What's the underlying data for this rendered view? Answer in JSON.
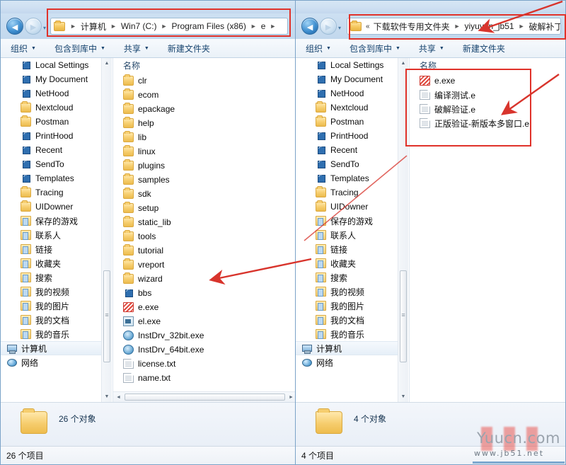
{
  "left_window": {
    "nav": {
      "back_label": "◄",
      "forward_label": "►",
      "dropdown": "▾"
    },
    "address": {
      "crumbs": [
        "计算机",
        "Win7 (C:)",
        "Program Files (x86)",
        "e"
      ],
      "separator": "►"
    },
    "toolbar": {
      "items": [
        {
          "label": "组织",
          "caret": "▼"
        },
        {
          "label": "包含到库中",
          "caret": "▼"
        },
        {
          "label": "共享",
          "caret": "▼"
        },
        {
          "label": "新建文件夹",
          "caret": ""
        }
      ]
    },
    "tree": [
      {
        "label": "Local Settings",
        "icon": "shortcut-icon"
      },
      {
        "label": "My Document",
        "icon": "shortcut-icon"
      },
      {
        "label": "NetHood",
        "icon": "shortcut-icon"
      },
      {
        "label": "Nextcloud",
        "icon": "folder-icon"
      },
      {
        "label": "Postman",
        "icon": "folder-icon"
      },
      {
        "label": "PrintHood",
        "icon": "shortcut-icon"
      },
      {
        "label": "Recent",
        "icon": "shortcut-icon"
      },
      {
        "label": "SendTo",
        "icon": "shortcut-icon"
      },
      {
        "label": "Templates",
        "icon": "shortcut-icon"
      },
      {
        "label": "Tracing",
        "icon": "folder-icon"
      },
      {
        "label": "UIDowner",
        "icon": "folder-icon"
      },
      {
        "label": "保存的游戏",
        "icon": "sys-folder-icon"
      },
      {
        "label": "联系人",
        "icon": "sys-folder-icon"
      },
      {
        "label": "链接",
        "icon": "sys-folder-icon"
      },
      {
        "label": "收藏夹",
        "icon": "sys-folder-icon"
      },
      {
        "label": "搜索",
        "icon": "sys-folder-icon"
      },
      {
        "label": "我的视频",
        "icon": "sys-folder-icon"
      },
      {
        "label": "我的图片",
        "icon": "sys-folder-icon"
      },
      {
        "label": "我的文档",
        "icon": "sys-folder-icon"
      },
      {
        "label": "我的音乐",
        "icon": "sys-folder-icon"
      }
    ],
    "tree_roots": [
      {
        "label": "计算机",
        "icon": "computer-icon"
      },
      {
        "label": "网络",
        "icon": "network-icon"
      }
    ],
    "column_header": "名称",
    "files": [
      {
        "name": "clr",
        "icon": "folder-icon"
      },
      {
        "name": "ecom",
        "icon": "folder-icon"
      },
      {
        "name": "epackage",
        "icon": "folder-icon"
      },
      {
        "name": "help",
        "icon": "folder-icon"
      },
      {
        "name": "lib",
        "icon": "folder-icon"
      },
      {
        "name": "linux",
        "icon": "folder-icon"
      },
      {
        "name": "plugins",
        "icon": "folder-icon"
      },
      {
        "name": "samples",
        "icon": "folder-icon"
      },
      {
        "name": "sdk",
        "icon": "folder-icon"
      },
      {
        "name": "setup",
        "icon": "folder-icon"
      },
      {
        "name": "static_lib",
        "icon": "folder-icon"
      },
      {
        "name": "tools",
        "icon": "folder-icon"
      },
      {
        "name": "tutorial",
        "icon": "folder-icon"
      },
      {
        "name": "vreport",
        "icon": "folder-icon"
      },
      {
        "name": "wizard",
        "icon": "folder-icon"
      },
      {
        "name": "bbs",
        "icon": "shortcut-icon"
      },
      {
        "name": "e.exe",
        "icon": "exe-red-icon"
      },
      {
        "name": "el.exe",
        "icon": "exe-blue-icon"
      },
      {
        "name": "InstDrv_32bit.exe",
        "icon": "gear-icon"
      },
      {
        "name": "InstDrv_64bit.exe",
        "icon": "gear-icon"
      },
      {
        "name": "license.txt",
        "icon": "text-file-icon"
      },
      {
        "name": "name.txt",
        "icon": "text-file-icon"
      }
    ],
    "details_count": "26 个对象",
    "status_text": "26 个项目"
  },
  "right_window": {
    "nav": {
      "back_label": "◄",
      "forward_label": "►",
      "dropdown": "▾"
    },
    "address": {
      "prefix": "«",
      "crumbs": [
        "下载软件专用文件夹",
        "yiyuyan_jb51",
        "破解补丁"
      ],
      "separator": "►"
    },
    "toolbar": {
      "items": [
        {
          "label": "组织",
          "caret": "▼"
        },
        {
          "label": "包含到库中",
          "caret": "▼"
        },
        {
          "label": "共享",
          "caret": "▼"
        },
        {
          "label": "新建文件夹",
          "caret": ""
        }
      ]
    },
    "tree": [
      {
        "label": "Local Settings",
        "icon": "shortcut-icon"
      },
      {
        "label": "My Document",
        "icon": "shortcut-icon"
      },
      {
        "label": "NetHood",
        "icon": "shortcut-icon"
      },
      {
        "label": "Nextcloud",
        "icon": "folder-icon"
      },
      {
        "label": "Postman",
        "icon": "folder-icon"
      },
      {
        "label": "PrintHood",
        "icon": "shortcut-icon"
      },
      {
        "label": "Recent",
        "icon": "shortcut-icon"
      },
      {
        "label": "SendTo",
        "icon": "shortcut-icon"
      },
      {
        "label": "Templates",
        "icon": "shortcut-icon"
      },
      {
        "label": "Tracing",
        "icon": "folder-icon"
      },
      {
        "label": "UIDowner",
        "icon": "folder-icon"
      },
      {
        "label": "保存的游戏",
        "icon": "sys-folder-icon"
      },
      {
        "label": "联系人",
        "icon": "sys-folder-icon"
      },
      {
        "label": "链接",
        "icon": "sys-folder-icon"
      },
      {
        "label": "收藏夹",
        "icon": "sys-folder-icon"
      },
      {
        "label": "搜索",
        "icon": "sys-folder-icon"
      },
      {
        "label": "我的视频",
        "icon": "sys-folder-icon"
      },
      {
        "label": "我的图片",
        "icon": "sys-folder-icon"
      },
      {
        "label": "我的文档",
        "icon": "sys-folder-icon"
      },
      {
        "label": "我的音乐",
        "icon": "sys-folder-icon"
      }
    ],
    "tree_roots": [
      {
        "label": "计算机",
        "icon": "computer-icon"
      },
      {
        "label": "网络",
        "icon": "network-icon"
      }
    ],
    "column_header": "名称",
    "files": [
      {
        "name": "e.exe",
        "icon": "exe-red-icon"
      },
      {
        "name": "编译测试.e",
        "icon": "text-file-icon"
      },
      {
        "name": "破解验证.e",
        "icon": "text-file-icon"
      },
      {
        "name": "正版验证-新版本多窗口.e",
        "icon": "text-file-icon"
      }
    ],
    "details_count": "4 个对象",
    "status_text": "4 个项目"
  },
  "annotations": {
    "accent_color": "#e0322a",
    "boxes": [
      {
        "name": "left-address-highlight"
      },
      {
        "name": "right-address-highlight"
      },
      {
        "name": "right-file-list-highlight"
      }
    ]
  },
  "watermark": {
    "main": "Yuucn.com",
    "sub": "www.jb51.net"
  }
}
